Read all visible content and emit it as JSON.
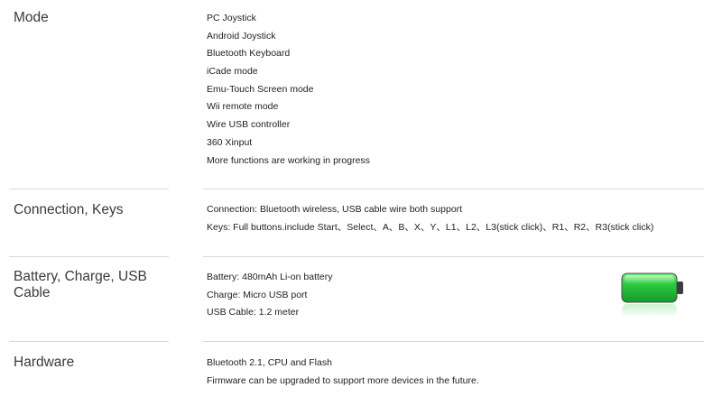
{
  "sections": [
    {
      "label": "Mode",
      "lines": [
        "PC Joystick",
        "Android Joystick",
        "Bluetooth Keyboard",
        "iCade mode",
        "Emu-Touch Screen mode",
        "Wii remote mode",
        "Wire USB controller",
        "360 Xinput",
        "More functions are working in progress"
      ]
    },
    {
      "label": "Connection, Keys",
      "lines": [
        "Connection: Bluetooth wireless, USB cable wire both support",
        "Keys: Full buttons.include Start、Select、A、B、X、Y、L1、L2、L3(stick click)、R1、R2、R3(stick click)"
      ]
    },
    {
      "label": "Battery, Charge, USB Cable",
      "lines": [
        "Battery: 480mAh Li-on battery",
        "Charge: Micro USB port",
        "USB Cable: 1.2 meter"
      ]
    },
    {
      "label": "Hardware",
      "lines": [
        "Bluetooth 2.1, CPU and Flash",
        "Firmware can be upgraded to support more devices in the future."
      ]
    }
  ],
  "battery_icon": {
    "icon": "battery-full-icon",
    "fill_level": 1.0,
    "color": "#2ecc40"
  },
  "colors": {
    "divider": "#d9d9d9",
    "label_text": "#3a3a3a",
    "body_text": "#222222"
  }
}
